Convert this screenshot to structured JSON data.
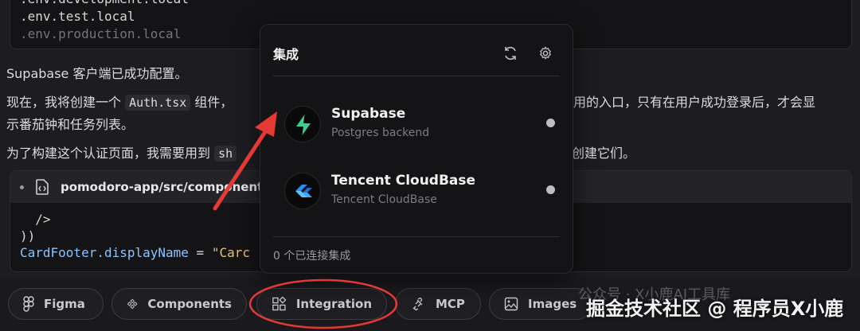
{
  "code_top": {
    "lines": [
      ".env.development.local",
      ".env.test.local",
      ".env.production.local"
    ]
  },
  "paragraphs": {
    "p1": "Supabase 客户端已成功配置。",
    "p2_before": "现在，我将创建一个 ",
    "p2_code": "Auth.tsx",
    "p2_after": " 组件，",
    "p2_right": "用的入口，只有在用户成功登录后，才会显",
    "p2_line2": "示番茄钟和任务列表。",
    "p3_left": "为了构建这个认证页面，我需要用到 ",
    "p3_code": "sh",
    "p3_right": "创建它们。"
  },
  "file_block": {
    "path": "pomodoro-app/src/components",
    "lines": {
      "l1": "  />",
      "l2": "))",
      "l3_prop": "CardFooter.displayName",
      "l3_eq": " = ",
      "l3_str": "\"Carc"
    }
  },
  "popover": {
    "title": "集成",
    "refresh_icon": "refresh-icon",
    "settings_icon": "gear-icon",
    "items": [
      {
        "name": "Supabase",
        "subtitle": "Postgres backend",
        "status_color": "#bdbdc2"
      },
      {
        "name": "Tencent CloudBase",
        "subtitle": "Tencent CloudBase",
        "status_color": "#bdbdc2"
      }
    ],
    "footer": "0 个已连接集成"
  },
  "toolbar": {
    "figma": "Figma",
    "components": "Components",
    "integration": "Integration",
    "mcp": "MCP",
    "images": "Images"
  },
  "watermark": {
    "main": "掘金技术社区 @ 程序员X小鹿",
    "faint": "公众号 · X小鹿AI工具库"
  },
  "colors": {
    "supabase_green": "#3ecf8e",
    "annotation_red": "#e53935",
    "cloudbase_blue": "#2d8cf0"
  }
}
